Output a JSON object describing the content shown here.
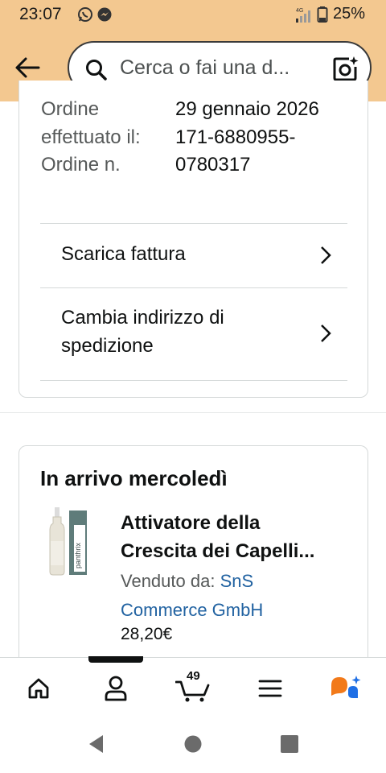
{
  "status_bar": {
    "time": "23:07",
    "network": "4G",
    "battery": "25%"
  },
  "header": {
    "search_placeholder": "Cerca o fai una d..."
  },
  "order_info": {
    "label_text": "Ordine effettuato il: Ordine n.",
    "date": "29 gennaio 2026",
    "order_number_line1": "171-6880955-",
    "order_number_line2": "0780317"
  },
  "actions": {
    "download_invoice": "Scarica fattura",
    "change_address_line1": "Cambia indirizzo di",
    "change_address_line2": "spedizione"
  },
  "shipment": {
    "arrival": "In arrivo mercoledì",
    "product_title_line1": "Attivatore della",
    "product_title_line2": "Crescita dei Capelli...",
    "sold_by_label": "Venduto da:",
    "seller_part1": "SnS",
    "seller_part2": "Commerce GmbH",
    "price": "28,20€",
    "thumb_brand": "panthrix"
  },
  "bottom_nav": {
    "items": [
      "home-icon",
      "account-icon",
      "cart-icon",
      "menu-icon",
      "rufus-icon"
    ],
    "cart_count": "49",
    "active_index": 1
  },
  "colors": {
    "header_bg": "#f3c890",
    "link": "#2162a1",
    "text": "#0f1111",
    "rufus_orange": "#f27a1a",
    "rufus_blue": "#1f6fe5"
  }
}
